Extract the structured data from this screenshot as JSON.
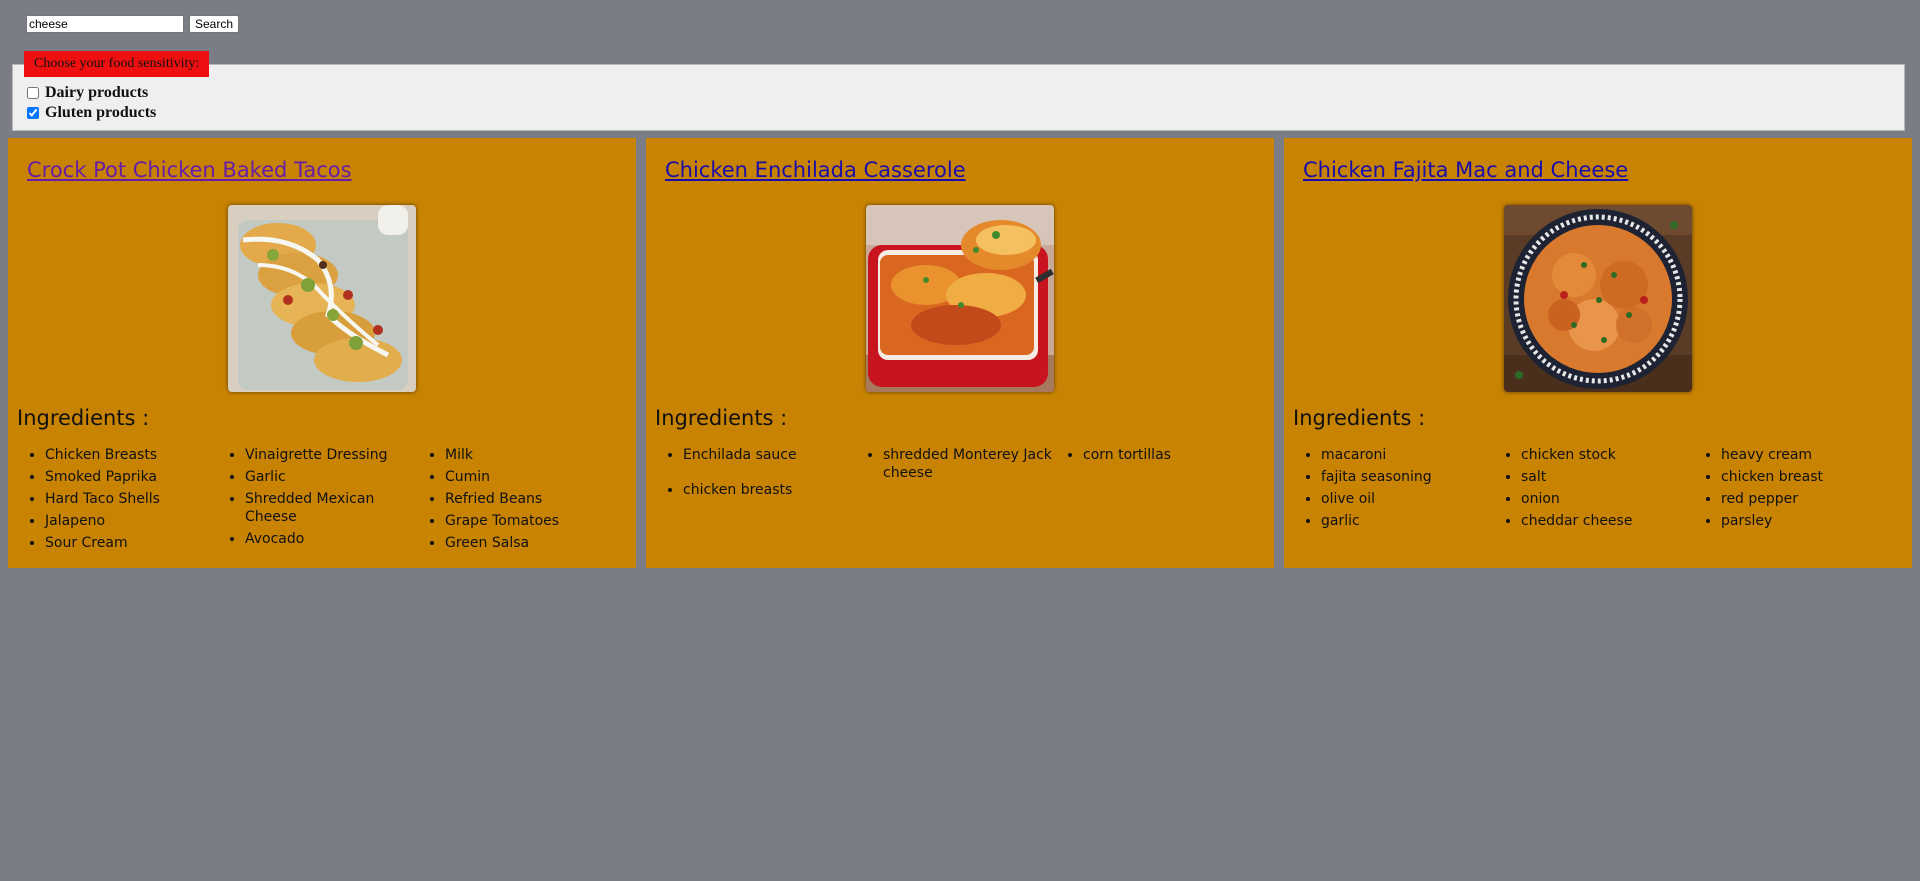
{
  "search": {
    "value": "cheese",
    "button_label": "Search"
  },
  "sensitivity": {
    "legend": "Choose your food sensitivity:",
    "options": [
      {
        "label": "Dairy products",
        "checked": false
      },
      {
        "label": "Gluten products",
        "checked": true
      }
    ]
  },
  "recipes": [
    {
      "title": "Crock Pot Chicken Baked Tacos",
      "visited": true,
      "ingredients_heading": "Ingredients :",
      "ingredients": [
        "Chicken Breasts",
        "Smoked Paprika",
        "Hard Taco Shells",
        "Jalapeno",
        "Sour Cream",
        "Vinaigrette Dressing",
        "Garlic",
        "Shredded Mexican Cheese",
        "Avocado",
        "Milk",
        "Cumin",
        "Refried Beans",
        "Grape Tomatoes",
        "Green Salsa"
      ]
    },
    {
      "title": "Chicken Enchilada Casserole",
      "visited": false,
      "ingredients_heading": "Ingredients :",
      "ingredients": [
        "Enchilada sauce",
        "chicken breasts",
        "shredded Monterey Jack cheese",
        "corn tortillas"
      ]
    },
    {
      "title": "Chicken Fajita Mac and Cheese",
      "visited": false,
      "ingredients_heading": "Ingredients :",
      "ingredients": [
        "macaroni",
        "fajita seasoning",
        "olive oil",
        "garlic",
        "chicken stock",
        "salt",
        "onion",
        "cheddar cheese",
        "heavy cream",
        "chicken breast",
        "red pepper",
        "parsley"
      ]
    }
  ],
  "colors": {
    "background": "#7a7d85",
    "card": "#c88303",
    "legend": "#ee1010",
    "link": "#1a0dab",
    "visited_link": "#681da8"
  }
}
